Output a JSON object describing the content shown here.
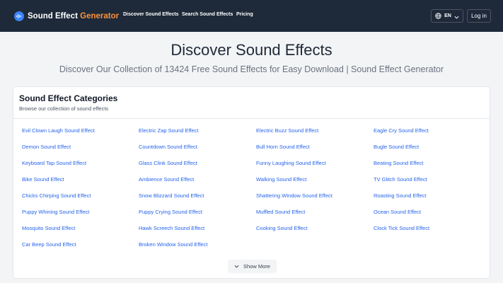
{
  "header": {
    "logo_main": "Sound Effect",
    "logo_accent": "Generator",
    "nav": [
      "Discover Sound Effects",
      "Search Sound Effects",
      "Pricing"
    ],
    "lang": "EN",
    "login": "Log in"
  },
  "hero": {
    "title": "Discover Sound Effects",
    "subtitle": "Discover Our Collection of 13424 Free Sound Effects for Easy Download | Sound Effect Generator"
  },
  "categories": {
    "title": "Sound Effect Categories",
    "description": "Browse our collection of sound effects",
    "columns": [
      [
        "Evil Clown Laugh Sound Effect",
        "Demon Sound Effect",
        "Keyboard Tap Sound Effect",
        "Bike Sound Effect",
        "Chicks Chirping Sound Effect",
        "Puppy Whining Sound Effect",
        "Mosquito Sound Effect",
        "Car Beep Sound Effect"
      ],
      [
        "Electric Zap Sound Effect",
        "Countdown Sound Effect",
        "Glass Clink Sound Effect",
        "Ambience Sound Effect",
        "Snow Blizzard Sound Effect",
        "Puppy Crying Sound Effect",
        "Hawk Screech Sound Effect",
        "Broken Window Sound Effect"
      ],
      [
        "Electric Buzz Sound Effect",
        "Bull Horn Sound Effect",
        "Funny Laughing Sound Effect",
        "Walking Sound Effect",
        "Shattering Window Sound Effect",
        "Muffled Sound Effect",
        "Cooking Sound Effect"
      ],
      [
        "Eagle Cry Sound Effect",
        "Bugle Sound Effect",
        "Beating Sound Effect",
        "TV Glitch Sound Effect",
        "Roasting Sound Effect",
        "Ocean Sound Effect",
        "Clock Tick Sound Effect"
      ]
    ],
    "show_more": "Show More"
  },
  "colors": {
    "nav_bg": "#1e2939",
    "accent": "#fb923c",
    "link": "#2563eb"
  }
}
